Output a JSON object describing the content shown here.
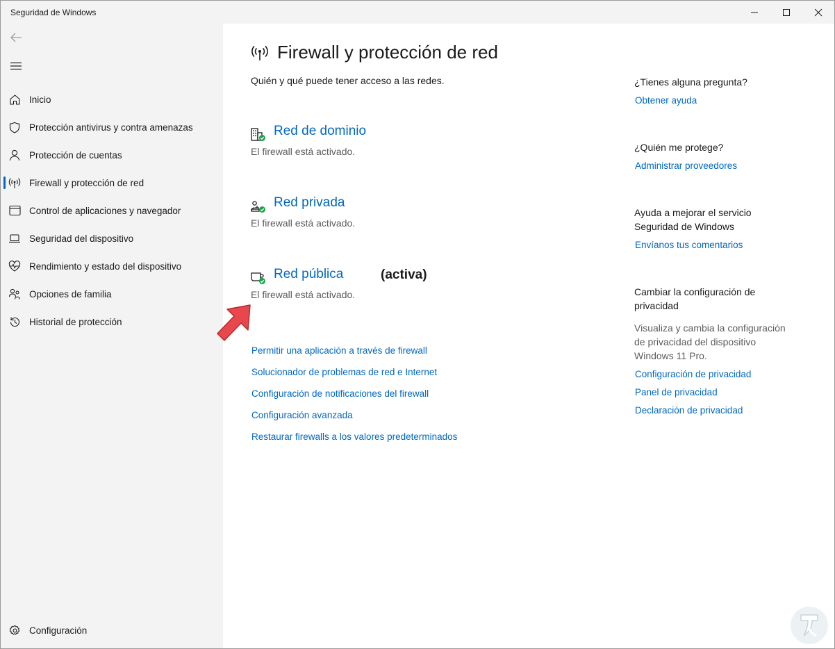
{
  "window": {
    "title": "Seguridad de Windows"
  },
  "sidebar": {
    "items": [
      {
        "label": "Inicio",
        "icon": "home-icon"
      },
      {
        "label": "Protección antivirus y contra amenazas",
        "icon": "shield-icon"
      },
      {
        "label": "Protección de cuentas",
        "icon": "person-icon"
      },
      {
        "label": "Firewall y protección de red",
        "icon": "antenna-icon",
        "active": true
      },
      {
        "label": "Control de aplicaciones y navegador",
        "icon": "app-browser-icon"
      },
      {
        "label": "Seguridad del dispositivo",
        "icon": "laptop-icon"
      },
      {
        "label": "Rendimiento y estado del dispositivo",
        "icon": "heart-pulse-icon"
      },
      {
        "label": "Opciones de familia",
        "icon": "family-icon"
      },
      {
        "label": "Historial de protección",
        "icon": "history-icon"
      }
    ],
    "settings_label": "Configuración"
  },
  "main": {
    "title": "Firewall y protección de red",
    "subtitle": "Quién y qué puede tener acceso a las redes.",
    "networks": [
      {
        "name": "Red de dominio",
        "status": "El firewall está activado.",
        "active_label": ""
      },
      {
        "name": "Red privada",
        "status": "El firewall está activado.",
        "active_label": ""
      },
      {
        "name": "Red pública",
        "status": "El firewall está activado.",
        "active_label": "(activa)"
      }
    ],
    "links": [
      "Permitir una aplicación a través de firewall",
      "Solucionador de problemas de red e Internet",
      "Configuración de notificaciones del firewall",
      "Configuración avanzada",
      "Restaurar firewalls a los valores predeterminados"
    ]
  },
  "right": {
    "question_head": "¿Tienes alguna pregunta?",
    "help_link": "Obtener ayuda",
    "protect_head": "¿Quién me protege?",
    "providers_link": "Administrar proveedores",
    "improve_head_1": "Ayuda a mejorar el servicio",
    "improve_head_2": "Seguridad de Windows",
    "feedback_link": "Envíanos tus comentarios",
    "privacy_head_1": "Cambiar la configuración de",
    "privacy_head_2": "privacidad",
    "privacy_text_1": "Visualiza y cambia la configuración",
    "privacy_text_2": "de privacidad del dispositivo",
    "privacy_text_3": "Windows 11 Pro.",
    "privacy_links": [
      "Configuración de privacidad",
      "Panel de privacidad",
      "Declaración de privacidad"
    ]
  },
  "colors": {
    "accent": "#0067c0",
    "sidebar_bg": "#f3f3f3",
    "check_green": "#16a34a",
    "annotation_arrow": "#e8484d"
  }
}
